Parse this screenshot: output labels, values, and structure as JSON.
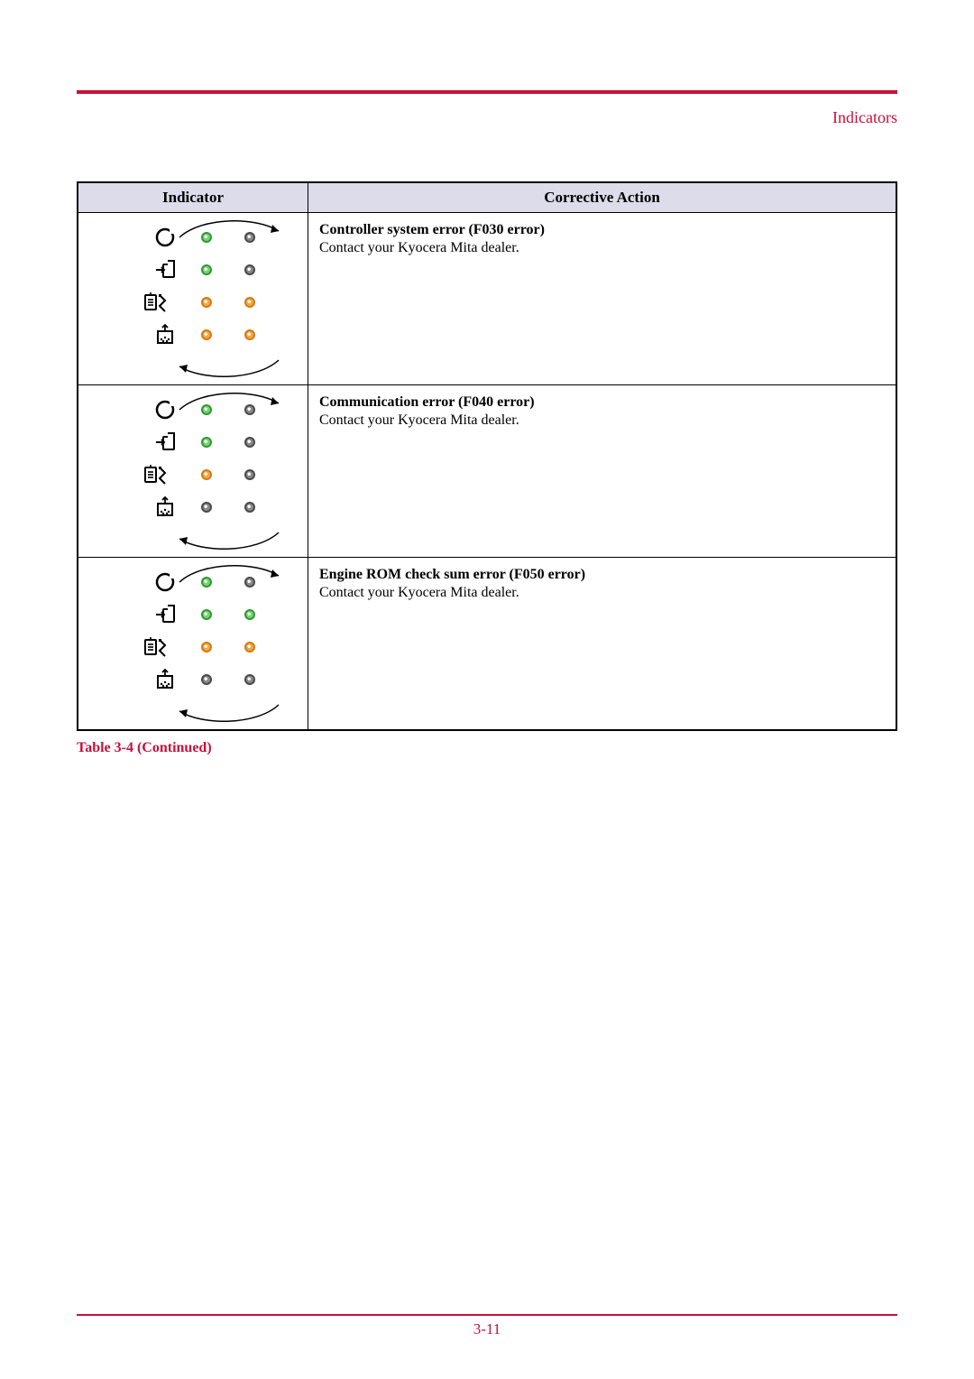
{
  "header": {
    "section": "Indicators"
  },
  "table": {
    "col1": "Indicator",
    "col2": "Corrective Action",
    "rows": [
      {
        "title": "Controller system error (F030 error)",
        "desc": "Contact your Kyocera Mita dealer.",
        "leds": [
          [
            "green",
            "off"
          ],
          [
            "green",
            "off"
          ],
          [
            "orange",
            "orange"
          ],
          [
            "orange",
            "orange"
          ]
        ]
      },
      {
        "title": "Communication error (F040 error)",
        "desc": "Contact your Kyocera Mita dealer.",
        "leds": [
          [
            "green",
            "off"
          ],
          [
            "green",
            "off"
          ],
          [
            "orange",
            "off"
          ],
          [
            "off",
            "off"
          ]
        ]
      },
      {
        "title": "Engine ROM check sum error (F050 error)",
        "desc": "Contact your Kyocera Mita dealer.",
        "leds": [
          [
            "green",
            "off"
          ],
          [
            "green",
            "green"
          ],
          [
            "orange",
            "orange"
          ],
          [
            "off",
            "off"
          ]
        ]
      }
    ]
  },
  "caption": "Table 3-4 (Continued)",
  "page_number": "3-11",
  "icons": {
    "ready": "ready-icon",
    "data": "data-icon",
    "paper": "paper-jam-icon",
    "toner": "toner-icon"
  }
}
